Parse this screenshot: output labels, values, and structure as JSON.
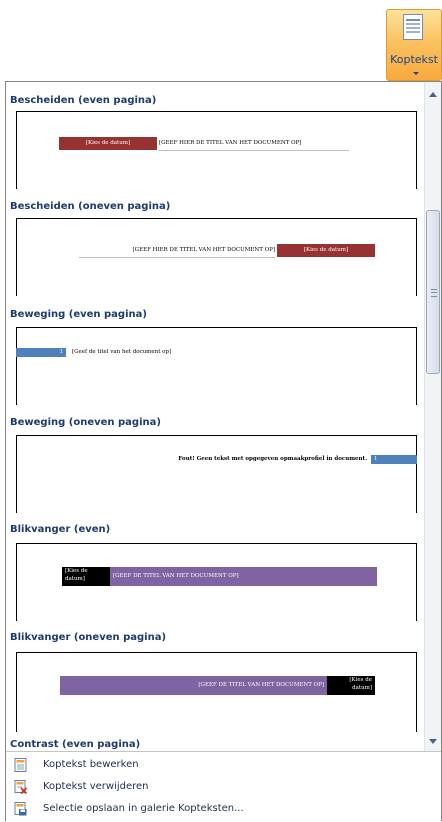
{
  "ribbon_button": {
    "label": "Koptekst",
    "icon": "header-document-icon"
  },
  "gallery": {
    "sections": [
      {
        "title": "Bescheiden (even pagina)",
        "date": "[Kies de datum]",
        "doc_title": "[GEEF HIER DE TITEL VAN HET DOCUMENT OP]"
      },
      {
        "title": "Bescheiden (oneven pagina)",
        "date": "[Kies de datum]",
        "doc_title": "[GEEF HIER DE TITEL VAN HET DOCUMENT OP]"
      },
      {
        "title": "Beweging (even pagina)",
        "page": "1",
        "doc_title": "[Geef de titel van het document op]"
      },
      {
        "title": "Beweging (oneven pagina)",
        "error": "Fout! Geen tekst met opgegeven opmaakprofiel in document.",
        "page": "1"
      },
      {
        "title": "Blikvanger (even)",
        "date_line1": "[Kies de",
        "date_line2": "datum]",
        "doc_title": "[GEEF DE TITEL VAN HET DOCUMENT OP]"
      },
      {
        "title": "Blikvanger (oneven pagina)",
        "date_line1": "[Kies de",
        "date_line2": "datum]",
        "doc_title": "[GEEF DE TITEL VAN HET DOCUMENT OP]"
      },
      {
        "title": "Contrast (even pagina)"
      }
    ]
  },
  "menu": {
    "items": [
      {
        "label": "Koptekst bewerken",
        "icon": "edit-header-icon"
      },
      {
        "label": "Koptekst verwijderen",
        "icon": "remove-header-icon"
      },
      {
        "label": "Selectie opslaan in galerie Kopteksten...",
        "icon": "save-selection-icon"
      }
    ]
  },
  "colors": {
    "section_title": "#1d3b6e",
    "bescheiden_date": "#963232",
    "beweging_blue": "#4f81bd",
    "blikvanger_purple": "#8064a2",
    "blikvanger_black": "#000000",
    "ribbon_active": "#fbc260"
  }
}
